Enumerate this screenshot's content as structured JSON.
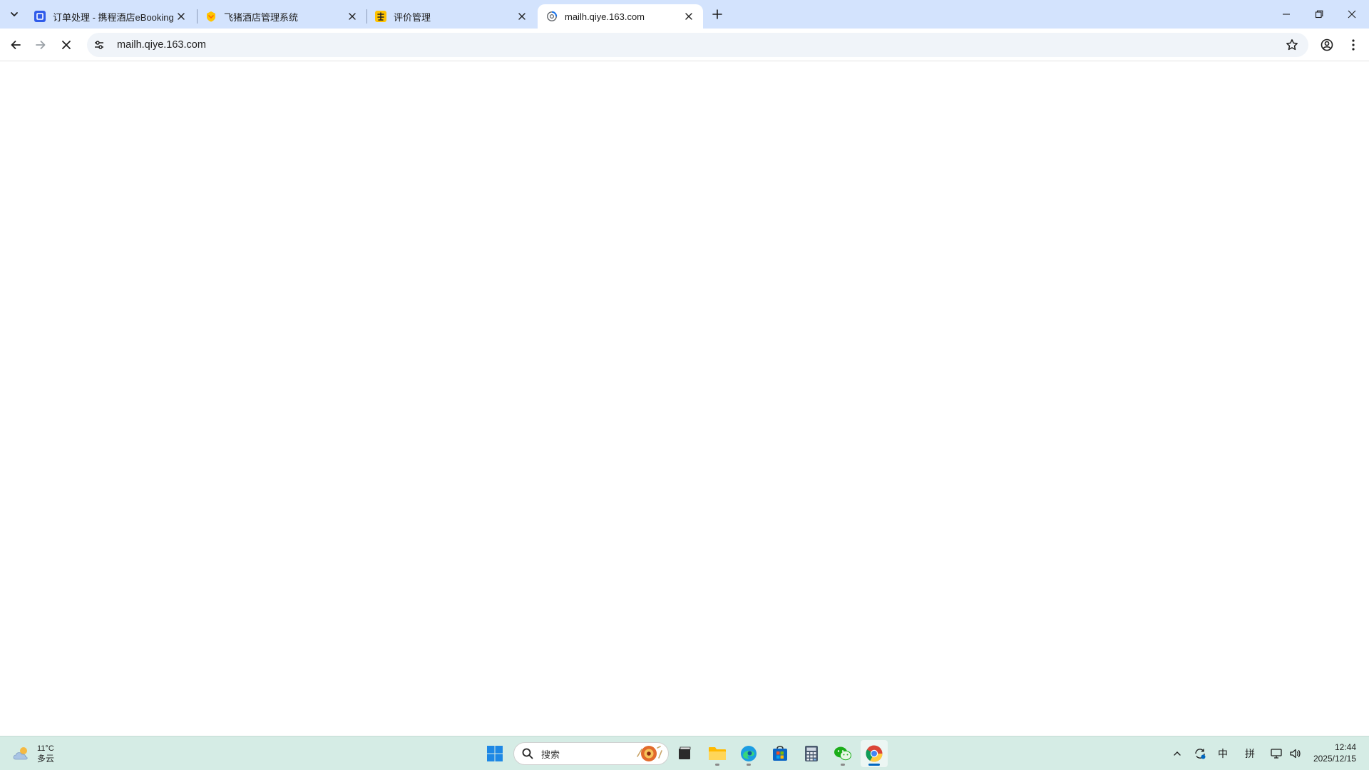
{
  "browser": {
    "tabs": [
      {
        "title": "订单处理 - 携程酒店eBooking",
        "active": false
      },
      {
        "title": "飞猪酒店管理系统",
        "active": false
      },
      {
        "title": "评价管理",
        "active": false
      },
      {
        "title": "mailh.qiye.163.com",
        "active": true
      }
    ],
    "address_bar": {
      "url": "mailh.qiye.163.com"
    },
    "colors": {
      "tabstrip": "#d3e3fd",
      "omnibox": "#f0f4f9"
    }
  },
  "taskbar": {
    "weather": {
      "temperature": "11°C",
      "condition": "多云"
    },
    "search": {
      "label": "搜索"
    },
    "tray": {
      "ime_mode": "中",
      "ime_method": "拼"
    },
    "clock": {
      "time": "12:44",
      "date": "2025/12/15"
    }
  }
}
